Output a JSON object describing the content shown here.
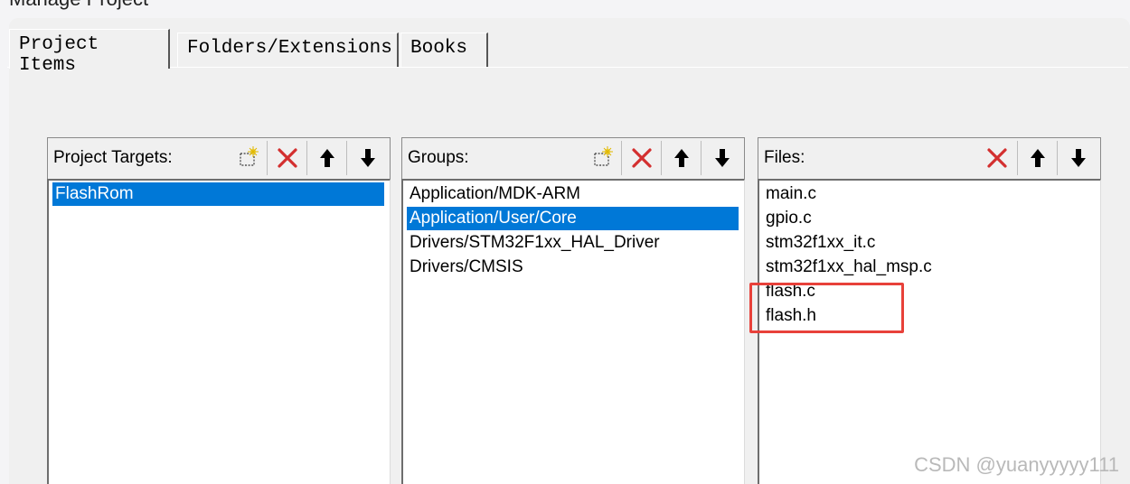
{
  "window": {
    "title_fragment": "Manage Project"
  },
  "tabs": [
    {
      "label": "Project Items",
      "active": true
    },
    {
      "label": "Folders/Extensions",
      "active": false
    },
    {
      "label": "Books",
      "active": false
    }
  ],
  "targets": {
    "header": "Project Targets:",
    "items": [
      {
        "label": "FlashRom",
        "selected": true
      }
    ]
  },
  "groups": {
    "header": "Groups:",
    "items": [
      {
        "label": "Application/MDK-ARM",
        "selected": false
      },
      {
        "label": "Application/User/Core",
        "selected": true
      },
      {
        "label": "Drivers/STM32F1xx_HAL_Driver",
        "selected": false
      },
      {
        "label": "Drivers/CMSIS",
        "selected": false
      }
    ]
  },
  "files": {
    "header": "Files:",
    "items": [
      {
        "label": "main.c"
      },
      {
        "label": "gpio.c"
      },
      {
        "label": "stm32f1xx_it.c"
      },
      {
        "label": "stm32f1xx_hal_msp.c"
      },
      {
        "label": "flash.c"
      },
      {
        "label": "flash.h"
      }
    ]
  },
  "toolbar_icons": [
    "new-icon",
    "delete-icon",
    "move-up-icon",
    "move-down-icon"
  ],
  "colors": {
    "selection": "#0078d7",
    "delete": "#d32f2f",
    "highlight": "#e8413a"
  },
  "watermark": "CSDN @yuanyyyyy111"
}
